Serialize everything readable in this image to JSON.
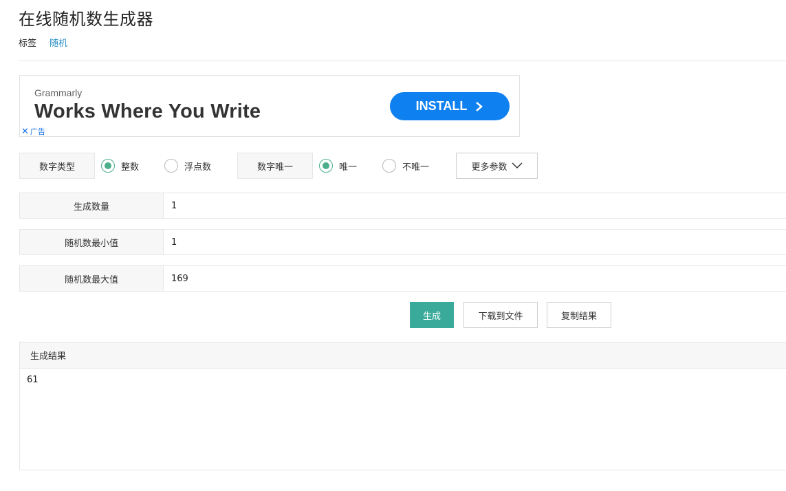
{
  "page": {
    "title": "在线随机数生成器",
    "tag_label": "标签",
    "tag_link": "随机"
  },
  "ad": {
    "brand": "Grammarly",
    "headline": "Works Where You Write",
    "cta": "INSTALL",
    "ad_label": "广告",
    "cta_color": "#0e80f0"
  },
  "options": {
    "number_type_label": "数字类型",
    "number_type_options": [
      "整数",
      "浮点数"
    ],
    "number_type_selected": "整数",
    "unique_label": "数字唯一",
    "unique_options": [
      "唯一",
      "不唯一"
    ],
    "unique_selected": "唯一",
    "more_params": "更多参数"
  },
  "fields": {
    "count_label": "生成数量",
    "count_value": "1",
    "min_label": "随机数最小值",
    "min_value": "1",
    "max_label": "随机数最大值",
    "max_value": "169"
  },
  "actions": {
    "generate": "生成",
    "download": "下载到文件",
    "copy": "复制结果",
    "primary_color": "#3aab9a"
  },
  "result": {
    "header": "生成结果",
    "value": "61"
  }
}
